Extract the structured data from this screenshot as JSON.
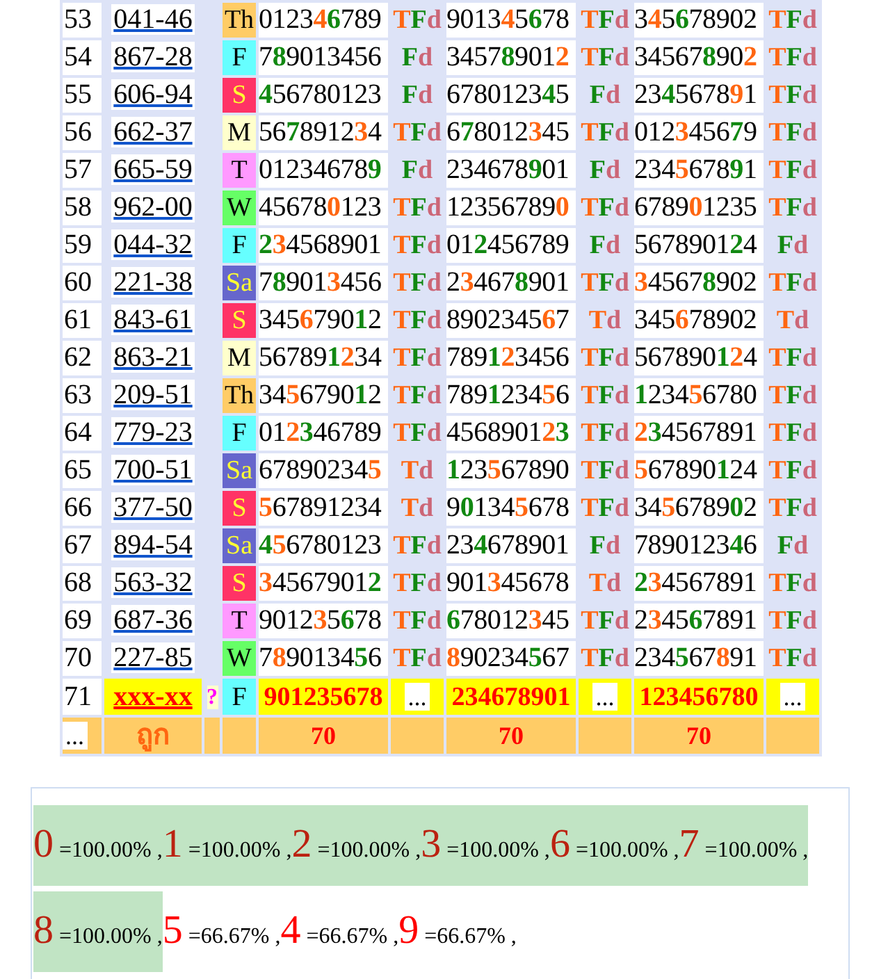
{
  "rows": [
    {
      "kind": "result",
      "num": "53",
      "code": "041-46",
      "day": "Th",
      "color": "#ffcc66",
      "numbers": [
        {
          "parts": [
            {
              "text": "0123",
              "kind": "n"
            },
            {
              "text": "4",
              "kind": "t"
            },
            {
              "text": "6",
              "kind": "f"
            },
            {
              "text": "789",
              "kind": "n"
            }
          ],
          "label": [
            {
              "text": "T",
              "kind": "t"
            },
            {
              "text": "F",
              "kind": "f"
            },
            {
              "text": "d",
              "kind": "d"
            }
          ]
        },
        {
          "parts": [
            {
              "text": "9013",
              "kind": "n"
            },
            {
              "text": "4",
              "kind": "t"
            },
            {
              "text": "5",
              "kind": "n"
            },
            {
              "text": "6",
              "kind": "f"
            },
            {
              "text": "78",
              "kind": "n"
            }
          ],
          "label": [
            {
              "text": "T",
              "kind": "t"
            },
            {
              "text": "F",
              "kind": "f"
            },
            {
              "text": "d",
              "kind": "d"
            }
          ]
        },
        {
          "parts": [
            {
              "text": "3",
              "kind": "n"
            },
            {
              "text": "4",
              "kind": "t"
            },
            {
              "text": "5",
              "kind": "n"
            },
            {
              "text": "6",
              "kind": "f"
            },
            {
              "text": "78902",
              "kind": "n"
            }
          ],
          "label": [
            {
              "text": "T",
              "kind": "t"
            },
            {
              "text": "F",
              "kind": "f"
            },
            {
              "text": "d",
              "kind": "d"
            }
          ]
        }
      ]
    },
    {
      "kind": "result",
      "num": "54",
      "code": "867-28",
      "day": "F",
      "color": "#66ffff",
      "numbers": [
        {
          "parts": [
            {
              "text": "7",
              "kind": "n"
            },
            {
              "text": "8",
              "kind": "f"
            },
            {
              "text": "9013456",
              "kind": "n"
            }
          ],
          "label": [
            {
              "text": "F",
              "kind": "f"
            },
            {
              "text": "d",
              "kind": "d"
            }
          ]
        },
        {
          "parts": [
            {
              "text": "3457",
              "kind": "n"
            },
            {
              "text": "8",
              "kind": "f"
            },
            {
              "text": "901",
              "kind": "n"
            },
            {
              "text": "2",
              "kind": "t"
            }
          ],
          "label": [
            {
              "text": "T",
              "kind": "t"
            },
            {
              "text": "F",
              "kind": "f"
            },
            {
              "text": "d",
              "kind": "d"
            }
          ]
        },
        {
          "parts": [
            {
              "text": "34567",
              "kind": "n"
            },
            {
              "text": "8",
              "kind": "f"
            },
            {
              "text": "90",
              "kind": "n"
            },
            {
              "text": "2",
              "kind": "t"
            }
          ],
          "label": [
            {
              "text": "T",
              "kind": "t"
            },
            {
              "text": "F",
              "kind": "f"
            },
            {
              "text": "d",
              "kind": "d"
            }
          ]
        }
      ]
    },
    {
      "kind": "result",
      "num": "55",
      "code": "606-94",
      "day": "S",
      "color": "#ff3366",
      "numbers": [
        {
          "parts": [
            {
              "text": "4",
              "kind": "f"
            },
            {
              "text": "56780123",
              "kind": "n"
            }
          ],
          "label": [
            {
              "text": "F",
              "kind": "f"
            },
            {
              "text": "d",
              "kind": "d"
            }
          ]
        },
        {
          "parts": [
            {
              "text": "6780123",
              "kind": "n"
            },
            {
              "text": "4",
              "kind": "f"
            },
            {
              "text": "5",
              "kind": "n"
            }
          ],
          "label": [
            {
              "text": "F",
              "kind": "f"
            },
            {
              "text": "d",
              "kind": "d"
            }
          ]
        },
        {
          "parts": [
            {
              "text": "23",
              "kind": "n"
            },
            {
              "text": "4",
              "kind": "f"
            },
            {
              "text": "5678",
              "kind": "n"
            },
            {
              "text": "9",
              "kind": "t"
            },
            {
              "text": "1",
              "kind": "n"
            }
          ],
          "label": [
            {
              "text": "T",
              "kind": "t"
            },
            {
              "text": "F",
              "kind": "f"
            },
            {
              "text": "d",
              "kind": "d"
            }
          ]
        }
      ]
    },
    {
      "kind": "result",
      "num": "56",
      "code": "662-37",
      "day": "M",
      "color": "#ffffcc",
      "numbers": [
        {
          "parts": [
            {
              "text": "56",
              "kind": "n"
            },
            {
              "text": "7",
              "kind": "f"
            },
            {
              "text": "8912",
              "kind": "n"
            },
            {
              "text": "3",
              "kind": "t"
            },
            {
              "text": "4",
              "kind": "n"
            }
          ],
          "label": [
            {
              "text": "T",
              "kind": "t"
            },
            {
              "text": "F",
              "kind": "f"
            },
            {
              "text": "d",
              "kind": "d"
            }
          ]
        },
        {
          "parts": [
            {
              "text": "6",
              "kind": "n"
            },
            {
              "text": "7",
              "kind": "f"
            },
            {
              "text": "8012",
              "kind": "n"
            },
            {
              "text": "3",
              "kind": "t"
            },
            {
              "text": "45",
              "kind": "n"
            }
          ],
          "label": [
            {
              "text": "T",
              "kind": "t"
            },
            {
              "text": "F",
              "kind": "f"
            },
            {
              "text": "d",
              "kind": "d"
            }
          ]
        },
        {
          "parts": [
            {
              "text": "012",
              "kind": "n"
            },
            {
              "text": "3",
              "kind": "t"
            },
            {
              "text": "456",
              "kind": "n"
            },
            {
              "text": "7",
              "kind": "f"
            },
            {
              "text": "9",
              "kind": "n"
            }
          ],
          "label": [
            {
              "text": "T",
              "kind": "t"
            },
            {
              "text": "F",
              "kind": "f"
            },
            {
              "text": "d",
              "kind": "d"
            }
          ]
        }
      ]
    },
    {
      "kind": "result",
      "num": "57",
      "code": "665-59",
      "day": "T",
      "color": "#ff99ff",
      "numbers": [
        {
          "parts": [
            {
              "text": "01234678",
              "kind": "n"
            },
            {
              "text": "9",
              "kind": "f"
            }
          ],
          "label": [
            {
              "text": "F",
              "kind": "f"
            },
            {
              "text": "d",
              "kind": "d"
            }
          ]
        },
        {
          "parts": [
            {
              "text": "234678",
              "kind": "n"
            },
            {
              "text": "9",
              "kind": "f"
            },
            {
              "text": "01",
              "kind": "n"
            }
          ],
          "label": [
            {
              "text": "F",
              "kind": "f"
            },
            {
              "text": "d",
              "kind": "d"
            }
          ]
        },
        {
          "parts": [
            {
              "text": "234",
              "kind": "n"
            },
            {
              "text": "5",
              "kind": "t"
            },
            {
              "text": "678",
              "kind": "n"
            },
            {
              "text": "9",
              "kind": "f"
            },
            {
              "text": "1",
              "kind": "n"
            }
          ],
          "label": [
            {
              "text": "T",
              "kind": "t"
            },
            {
              "text": "F",
              "kind": "f"
            },
            {
              "text": "d",
              "kind": "d"
            }
          ]
        }
      ]
    },
    {
      "kind": "result",
      "num": "58",
      "code": "962-00",
      "day": "W",
      "color": "#66ff66",
      "numbers": [
        {
          "parts": [
            {
              "text": "45678",
              "kind": "n"
            },
            {
              "text": "0",
              "kind": "t"
            },
            {
              "text": "123",
              "kind": "n"
            }
          ],
          "label": [
            {
              "text": "T",
              "kind": "t"
            },
            {
              "text": "F",
              "kind": "f"
            },
            {
              "text": "d",
              "kind": "d"
            }
          ]
        },
        {
          "parts": [
            {
              "text": "12356789",
              "kind": "n"
            },
            {
              "text": "0",
              "kind": "t"
            }
          ],
          "label": [
            {
              "text": "T",
              "kind": "t"
            },
            {
              "text": "F",
              "kind": "f"
            },
            {
              "text": "d",
              "kind": "d"
            }
          ]
        },
        {
          "parts": [
            {
              "text": "6789",
              "kind": "n"
            },
            {
              "text": "0",
              "kind": "t"
            },
            {
              "text": "1235",
              "kind": "n"
            }
          ],
          "label": [
            {
              "text": "T",
              "kind": "t"
            },
            {
              "text": "F",
              "kind": "f"
            },
            {
              "text": "d",
              "kind": "d"
            }
          ]
        }
      ]
    },
    {
      "kind": "result",
      "num": "59",
      "code": "044-32",
      "day": "F",
      "color": "#66ffff",
      "numbers": [
        {
          "parts": [
            {
              "text": "2",
              "kind": "f"
            },
            {
              "text": "3",
              "kind": "t"
            },
            {
              "text": "4568901",
              "kind": "n"
            }
          ],
          "label": [
            {
              "text": "T",
              "kind": "t"
            },
            {
              "text": "F",
              "kind": "f"
            },
            {
              "text": "d",
              "kind": "d"
            }
          ]
        },
        {
          "parts": [
            {
              "text": "01",
              "kind": "n"
            },
            {
              "text": "2",
              "kind": "f"
            },
            {
              "text": "456789",
              "kind": "n"
            }
          ],
          "label": [
            {
              "text": "F",
              "kind": "f"
            },
            {
              "text": "d",
              "kind": "d"
            }
          ]
        },
        {
          "parts": [
            {
              "text": "5678901",
              "kind": "n"
            },
            {
              "text": "2",
              "kind": "f"
            },
            {
              "text": "4",
              "kind": "n"
            }
          ],
          "label": [
            {
              "text": "F",
              "kind": "f"
            },
            {
              "text": "d",
              "kind": "d"
            }
          ]
        }
      ]
    },
    {
      "kind": "result",
      "num": "60",
      "code": "221-38",
      "day": "Sa",
      "color": "#6666cc",
      "numbers": [
        {
          "parts": [
            {
              "text": "7",
              "kind": "n"
            },
            {
              "text": "8",
              "kind": "f"
            },
            {
              "text": "901",
              "kind": "n"
            },
            {
              "text": "3",
              "kind": "t"
            },
            {
              "text": "456",
              "kind": "n"
            }
          ],
          "label": [
            {
              "text": "T",
              "kind": "t"
            },
            {
              "text": "F",
              "kind": "f"
            },
            {
              "text": "d",
              "kind": "d"
            }
          ]
        },
        {
          "parts": [
            {
              "text": "2",
              "kind": "n"
            },
            {
              "text": "3",
              "kind": "t"
            },
            {
              "text": "467",
              "kind": "n"
            },
            {
              "text": "8",
              "kind": "f"
            },
            {
              "text": "901",
              "kind": "n"
            }
          ],
          "label": [
            {
              "text": "T",
              "kind": "t"
            },
            {
              "text": "F",
              "kind": "f"
            },
            {
              "text": "d",
              "kind": "d"
            }
          ]
        },
        {
          "parts": [
            {
              "text": "3",
              "kind": "t"
            },
            {
              "text": "4567",
              "kind": "n"
            },
            {
              "text": "8",
              "kind": "f"
            },
            {
              "text": "902",
              "kind": "n"
            }
          ],
          "label": [
            {
              "text": "T",
              "kind": "t"
            },
            {
              "text": "F",
              "kind": "f"
            },
            {
              "text": "d",
              "kind": "d"
            }
          ]
        }
      ]
    },
    {
      "kind": "result",
      "num": "61",
      "code": "843-61",
      "day": "S",
      "color": "#ff3366",
      "numbers": [
        {
          "parts": [
            {
              "text": "345",
              "kind": "n"
            },
            {
              "text": "6",
              "kind": "t"
            },
            {
              "text": "790",
              "kind": "n"
            },
            {
              "text": "1",
              "kind": "f"
            },
            {
              "text": "2",
              "kind": "n"
            }
          ],
          "label": [
            {
              "text": "T",
              "kind": "t"
            },
            {
              "text": "F",
              "kind": "f"
            },
            {
              "text": "d",
              "kind": "d"
            }
          ]
        },
        {
          "parts": [
            {
              "text": "8902345",
              "kind": "n"
            },
            {
              "text": "6",
              "kind": "t"
            },
            {
              "text": "7",
              "kind": "n"
            }
          ],
          "label": [
            {
              "text": "T",
              "kind": "t"
            },
            {
              "text": "d",
              "kind": "d"
            }
          ]
        },
        {
          "parts": [
            {
              "text": "345",
              "kind": "n"
            },
            {
              "text": "6",
              "kind": "t"
            },
            {
              "text": "78902",
              "kind": "n"
            }
          ],
          "label": [
            {
              "text": "T",
              "kind": "t"
            },
            {
              "text": "d",
              "kind": "d"
            }
          ]
        }
      ]
    },
    {
      "kind": "result",
      "num": "62",
      "code": "863-21",
      "day": "M",
      "color": "#ffffcc",
      "numbers": [
        {
          "parts": [
            {
              "text": "56789",
              "kind": "n"
            },
            {
              "text": "1",
              "kind": "f"
            },
            {
              "text": "2",
              "kind": "t"
            },
            {
              "text": "34",
              "kind": "n"
            }
          ],
          "label": [
            {
              "text": "T",
              "kind": "t"
            },
            {
              "text": "F",
              "kind": "f"
            },
            {
              "text": "d",
              "kind": "d"
            }
          ]
        },
        {
          "parts": [
            {
              "text": "789",
              "kind": "n"
            },
            {
              "text": "1",
              "kind": "f"
            },
            {
              "text": "2",
              "kind": "t"
            },
            {
              "text": "3456",
              "kind": "n"
            }
          ],
          "label": [
            {
              "text": "T",
              "kind": "t"
            },
            {
              "text": "F",
              "kind": "f"
            },
            {
              "text": "d",
              "kind": "d"
            }
          ]
        },
        {
          "parts": [
            {
              "text": "567890",
              "kind": "n"
            },
            {
              "text": "1",
              "kind": "f"
            },
            {
              "text": "2",
              "kind": "t"
            },
            {
              "text": "4",
              "kind": "n"
            }
          ],
          "label": [
            {
              "text": "T",
              "kind": "t"
            },
            {
              "text": "F",
              "kind": "f"
            },
            {
              "text": "d",
              "kind": "d"
            }
          ]
        }
      ]
    },
    {
      "kind": "result",
      "num": "63",
      "code": "209-51",
      "day": "Th",
      "color": "#ffcc66",
      "numbers": [
        {
          "parts": [
            {
              "text": "34",
              "kind": "n"
            },
            {
              "text": "5",
              "kind": "t"
            },
            {
              "text": "6790",
              "kind": "n"
            },
            {
              "text": "1",
              "kind": "f"
            },
            {
              "text": "2",
              "kind": "n"
            }
          ],
          "label": [
            {
              "text": "T",
              "kind": "t"
            },
            {
              "text": "F",
              "kind": "f"
            },
            {
              "text": "d",
              "kind": "d"
            }
          ]
        },
        {
          "parts": [
            {
              "text": "789",
              "kind": "n"
            },
            {
              "text": "1",
              "kind": "f"
            },
            {
              "text": "234",
              "kind": "n"
            },
            {
              "text": "5",
              "kind": "t"
            },
            {
              "text": "6",
              "kind": "n"
            }
          ],
          "label": [
            {
              "text": "T",
              "kind": "t"
            },
            {
              "text": "F",
              "kind": "f"
            },
            {
              "text": "d",
              "kind": "d"
            }
          ]
        },
        {
          "parts": [
            {
              "text": "1",
              "kind": "f"
            },
            {
              "text": "234",
              "kind": "n"
            },
            {
              "text": "5",
              "kind": "t"
            },
            {
              "text": "6780",
              "kind": "n"
            }
          ],
          "label": [
            {
              "text": "T",
              "kind": "t"
            },
            {
              "text": "F",
              "kind": "f"
            },
            {
              "text": "d",
              "kind": "d"
            }
          ]
        }
      ]
    },
    {
      "kind": "result",
      "num": "64",
      "code": "779-23",
      "day": "F",
      "color": "#66ffff",
      "numbers": [
        {
          "parts": [
            {
              "text": "01",
              "kind": "n"
            },
            {
              "text": "2",
              "kind": "t"
            },
            {
              "text": "3",
              "kind": "f"
            },
            {
              "text": "46789",
              "kind": "n"
            }
          ],
          "label": [
            {
              "text": "T",
              "kind": "t"
            },
            {
              "text": "F",
              "kind": "f"
            },
            {
              "text": "d",
              "kind": "d"
            }
          ]
        },
        {
          "parts": [
            {
              "text": "4568901",
              "kind": "n"
            },
            {
              "text": "2",
              "kind": "t"
            },
            {
              "text": "3",
              "kind": "f"
            }
          ],
          "label": [
            {
              "text": "T",
              "kind": "t"
            },
            {
              "text": "F",
              "kind": "f"
            },
            {
              "text": "d",
              "kind": "d"
            }
          ]
        },
        {
          "parts": [
            {
              "text": "2",
              "kind": "t"
            },
            {
              "text": "3",
              "kind": "f"
            },
            {
              "text": "4567891",
              "kind": "n"
            }
          ],
          "label": [
            {
              "text": "T",
              "kind": "t"
            },
            {
              "text": "F",
              "kind": "f"
            },
            {
              "text": "d",
              "kind": "d"
            }
          ]
        }
      ]
    },
    {
      "kind": "result",
      "num": "65",
      "code": "700-51",
      "day": "Sa",
      "color": "#6666cc",
      "numbers": [
        {
          "parts": [
            {
              "text": "67890234",
              "kind": "n"
            },
            {
              "text": "5",
              "kind": "t"
            }
          ],
          "label": [
            {
              "text": "T",
              "kind": "t"
            },
            {
              "text": "d",
              "kind": "d"
            }
          ]
        },
        {
          "parts": [
            {
              "text": "1",
              "kind": "f"
            },
            {
              "text": "23",
              "kind": "n"
            },
            {
              "text": "5",
              "kind": "t"
            },
            {
              "text": "67890",
              "kind": "n"
            }
          ],
          "label": [
            {
              "text": "T",
              "kind": "t"
            },
            {
              "text": "F",
              "kind": "f"
            },
            {
              "text": "d",
              "kind": "d"
            }
          ]
        },
        {
          "parts": [
            {
              "text": "5",
              "kind": "t"
            },
            {
              "text": "67890",
              "kind": "n"
            },
            {
              "text": "1",
              "kind": "f"
            },
            {
              "text": "24",
              "kind": "n"
            }
          ],
          "label": [
            {
              "text": "T",
              "kind": "t"
            },
            {
              "text": "F",
              "kind": "f"
            },
            {
              "text": "d",
              "kind": "d"
            }
          ]
        }
      ]
    },
    {
      "kind": "result",
      "num": "66",
      "code": "377-50",
      "day": "S",
      "color": "#ff3366",
      "numbers": [
        {
          "parts": [
            {
              "text": "5",
              "kind": "t"
            },
            {
              "text": "67891234",
              "kind": "n"
            }
          ],
          "label": [
            {
              "text": "T",
              "kind": "t"
            },
            {
              "text": "d",
              "kind": "d"
            }
          ]
        },
        {
          "parts": [
            {
              "text": "9",
              "kind": "n"
            },
            {
              "text": "0",
              "kind": "f"
            },
            {
              "text": "134",
              "kind": "n"
            },
            {
              "text": "5",
              "kind": "t"
            },
            {
              "text": "678",
              "kind": "n"
            }
          ],
          "label": [
            {
              "text": "T",
              "kind": "t"
            },
            {
              "text": "F",
              "kind": "f"
            },
            {
              "text": "d",
              "kind": "d"
            }
          ]
        },
        {
          "parts": [
            {
              "text": "34",
              "kind": "n"
            },
            {
              "text": "5",
              "kind": "t"
            },
            {
              "text": "6789",
              "kind": "n"
            },
            {
              "text": "0",
              "kind": "f"
            },
            {
              "text": "2",
              "kind": "n"
            }
          ],
          "label": [
            {
              "text": "T",
              "kind": "t"
            },
            {
              "text": "F",
              "kind": "f"
            },
            {
              "text": "d",
              "kind": "d"
            }
          ]
        }
      ]
    },
    {
      "kind": "result",
      "num": "67",
      "code": "894-54",
      "day": "Sa",
      "color": "#6666cc",
      "numbers": [
        {
          "parts": [
            {
              "text": "4",
              "kind": "f"
            },
            {
              "text": "5",
              "kind": "t"
            },
            {
              "text": "6780123",
              "kind": "n"
            }
          ],
          "label": [
            {
              "text": "T",
              "kind": "t"
            },
            {
              "text": "F",
              "kind": "f"
            },
            {
              "text": "d",
              "kind": "d"
            }
          ]
        },
        {
          "parts": [
            {
              "text": "23",
              "kind": "n"
            },
            {
              "text": "4",
              "kind": "f"
            },
            {
              "text": "678901",
              "kind": "n"
            }
          ],
          "label": [
            {
              "text": "F",
              "kind": "f"
            },
            {
              "text": "d",
              "kind": "d"
            }
          ]
        },
        {
          "parts": [
            {
              "text": "7890123",
              "kind": "n"
            },
            {
              "text": "4",
              "kind": "f"
            },
            {
              "text": "6",
              "kind": "n"
            }
          ],
          "label": [
            {
              "text": "F",
              "kind": "f"
            },
            {
              "text": "d",
              "kind": "d"
            }
          ]
        }
      ]
    },
    {
      "kind": "result",
      "num": "68",
      "code": "563-32",
      "day": "S",
      "color": "#ff3366",
      "numbers": [
        {
          "parts": [
            {
              "text": "3",
              "kind": "t"
            },
            {
              "text": "4567901",
              "kind": "n"
            },
            {
              "text": "2",
              "kind": "f"
            }
          ],
          "label": [
            {
              "text": "T",
              "kind": "t"
            },
            {
              "text": "F",
              "kind": "f"
            },
            {
              "text": "d",
              "kind": "d"
            }
          ]
        },
        {
          "parts": [
            {
              "text": "901",
              "kind": "n"
            },
            {
              "text": "3",
              "kind": "t"
            },
            {
              "text": "45678",
              "kind": "n"
            }
          ],
          "label": [
            {
              "text": "T",
              "kind": "t"
            },
            {
              "text": "d",
              "kind": "d"
            }
          ]
        },
        {
          "parts": [
            {
              "text": "2",
              "kind": "f"
            },
            {
              "text": "3",
              "kind": "t"
            },
            {
              "text": "4567891",
              "kind": "n"
            }
          ],
          "label": [
            {
              "text": "T",
              "kind": "t"
            },
            {
              "text": "F",
              "kind": "f"
            },
            {
              "text": "d",
              "kind": "d"
            }
          ]
        }
      ]
    },
    {
      "kind": "result",
      "num": "69",
      "code": "687-36",
      "day": "T",
      "color": "#ff99ff",
      "numbers": [
        {
          "parts": [
            {
              "text": "9012",
              "kind": "n"
            },
            {
              "text": "3",
              "kind": "t"
            },
            {
              "text": "5",
              "kind": "n"
            },
            {
              "text": "6",
              "kind": "f"
            },
            {
              "text": "78",
              "kind": "n"
            }
          ],
          "label": [
            {
              "text": "T",
              "kind": "t"
            },
            {
              "text": "F",
              "kind": "f"
            },
            {
              "text": "d",
              "kind": "d"
            }
          ]
        },
        {
          "parts": [
            {
              "text": "6",
              "kind": "f"
            },
            {
              "text": "78012",
              "kind": "n"
            },
            {
              "text": "3",
              "kind": "t"
            },
            {
              "text": "45",
              "kind": "n"
            }
          ],
          "label": [
            {
              "text": "T",
              "kind": "t"
            },
            {
              "text": "F",
              "kind": "f"
            },
            {
              "text": "d",
              "kind": "d"
            }
          ]
        },
        {
          "parts": [
            {
              "text": "2",
              "kind": "n"
            },
            {
              "text": "3",
              "kind": "t"
            },
            {
              "text": "45",
              "kind": "n"
            },
            {
              "text": "6",
              "kind": "f"
            },
            {
              "text": "7891",
              "kind": "n"
            }
          ],
          "label": [
            {
              "text": "T",
              "kind": "t"
            },
            {
              "text": "F",
              "kind": "f"
            },
            {
              "text": "d",
              "kind": "d"
            }
          ]
        }
      ]
    },
    {
      "kind": "result",
      "num": "70",
      "code": "227-85",
      "day": "W",
      "color": "#66ff66",
      "numbers": [
        {
          "parts": [
            {
              "text": "7",
              "kind": "n"
            },
            {
              "text": "8",
              "kind": "t"
            },
            {
              "text": "90134",
              "kind": "n"
            },
            {
              "text": "5",
              "kind": "f"
            },
            {
              "text": "6",
              "kind": "n"
            }
          ],
          "label": [
            {
              "text": "T",
              "kind": "t"
            },
            {
              "text": "F",
              "kind": "f"
            },
            {
              "text": "d",
              "kind": "d"
            }
          ]
        },
        {
          "parts": [
            {
              "text": "8",
              "kind": "t"
            },
            {
              "text": "90234",
              "kind": "n"
            },
            {
              "text": "5",
              "kind": "f"
            },
            {
              "text": "67",
              "kind": "n"
            }
          ],
          "label": [
            {
              "text": "T",
              "kind": "t"
            },
            {
              "text": "F",
              "kind": "f"
            },
            {
              "text": "d",
              "kind": "d"
            }
          ]
        },
        {
          "parts": [
            {
              "text": "234",
              "kind": "n"
            },
            {
              "text": "5",
              "kind": "f"
            },
            {
              "text": "67",
              "kind": "n"
            },
            {
              "text": "8",
              "kind": "t"
            },
            {
              "text": "91",
              "kind": "n"
            }
          ],
          "label": [
            {
              "text": "T",
              "kind": "t"
            },
            {
              "text": "F",
              "kind": "f"
            },
            {
              "text": "d",
              "kind": "d"
            }
          ]
        }
      ]
    },
    {
      "kind": "pending",
      "num": "71",
      "code": "xxx-xx",
      "mark": "?",
      "day": "F",
      "color": "#66ffff",
      "numbers": [
        {
          "text": "901235678",
          "label": "..."
        },
        {
          "text": "234678901",
          "label": "..."
        },
        {
          "text": "123456780",
          "label": "..."
        }
      ]
    }
  ],
  "footer": {
    "more": "...",
    "label": "ถูก",
    "counts": [
      "70",
      "70",
      "70"
    ]
  },
  "summary": [
    {
      "digit": "0",
      "text": "=100.00% ,",
      "hit": true
    },
    {
      "digit": "1",
      "text": "=100.00% ,",
      "hit": true
    },
    {
      "digit": "2",
      "text": "=100.00% ,",
      "hit": true
    },
    {
      "digit": "3",
      "text": "=100.00% ,",
      "hit": true
    },
    {
      "digit": "6",
      "text": "=100.00% ,",
      "hit": true
    },
    {
      "digit": "7",
      "text": "=100.00% ,",
      "hit": true
    },
    {
      "digit": "8",
      "text": "=100.00% ,",
      "hit": true
    },
    {
      "digit": "5",
      "text": "=66.67% ,",
      "hit": false
    },
    {
      "digit": "4",
      "text": "=66.67% ,",
      "hit": false
    },
    {
      "digit": "9",
      "text": "=66.67% ,",
      "hit": false
    }
  ]
}
